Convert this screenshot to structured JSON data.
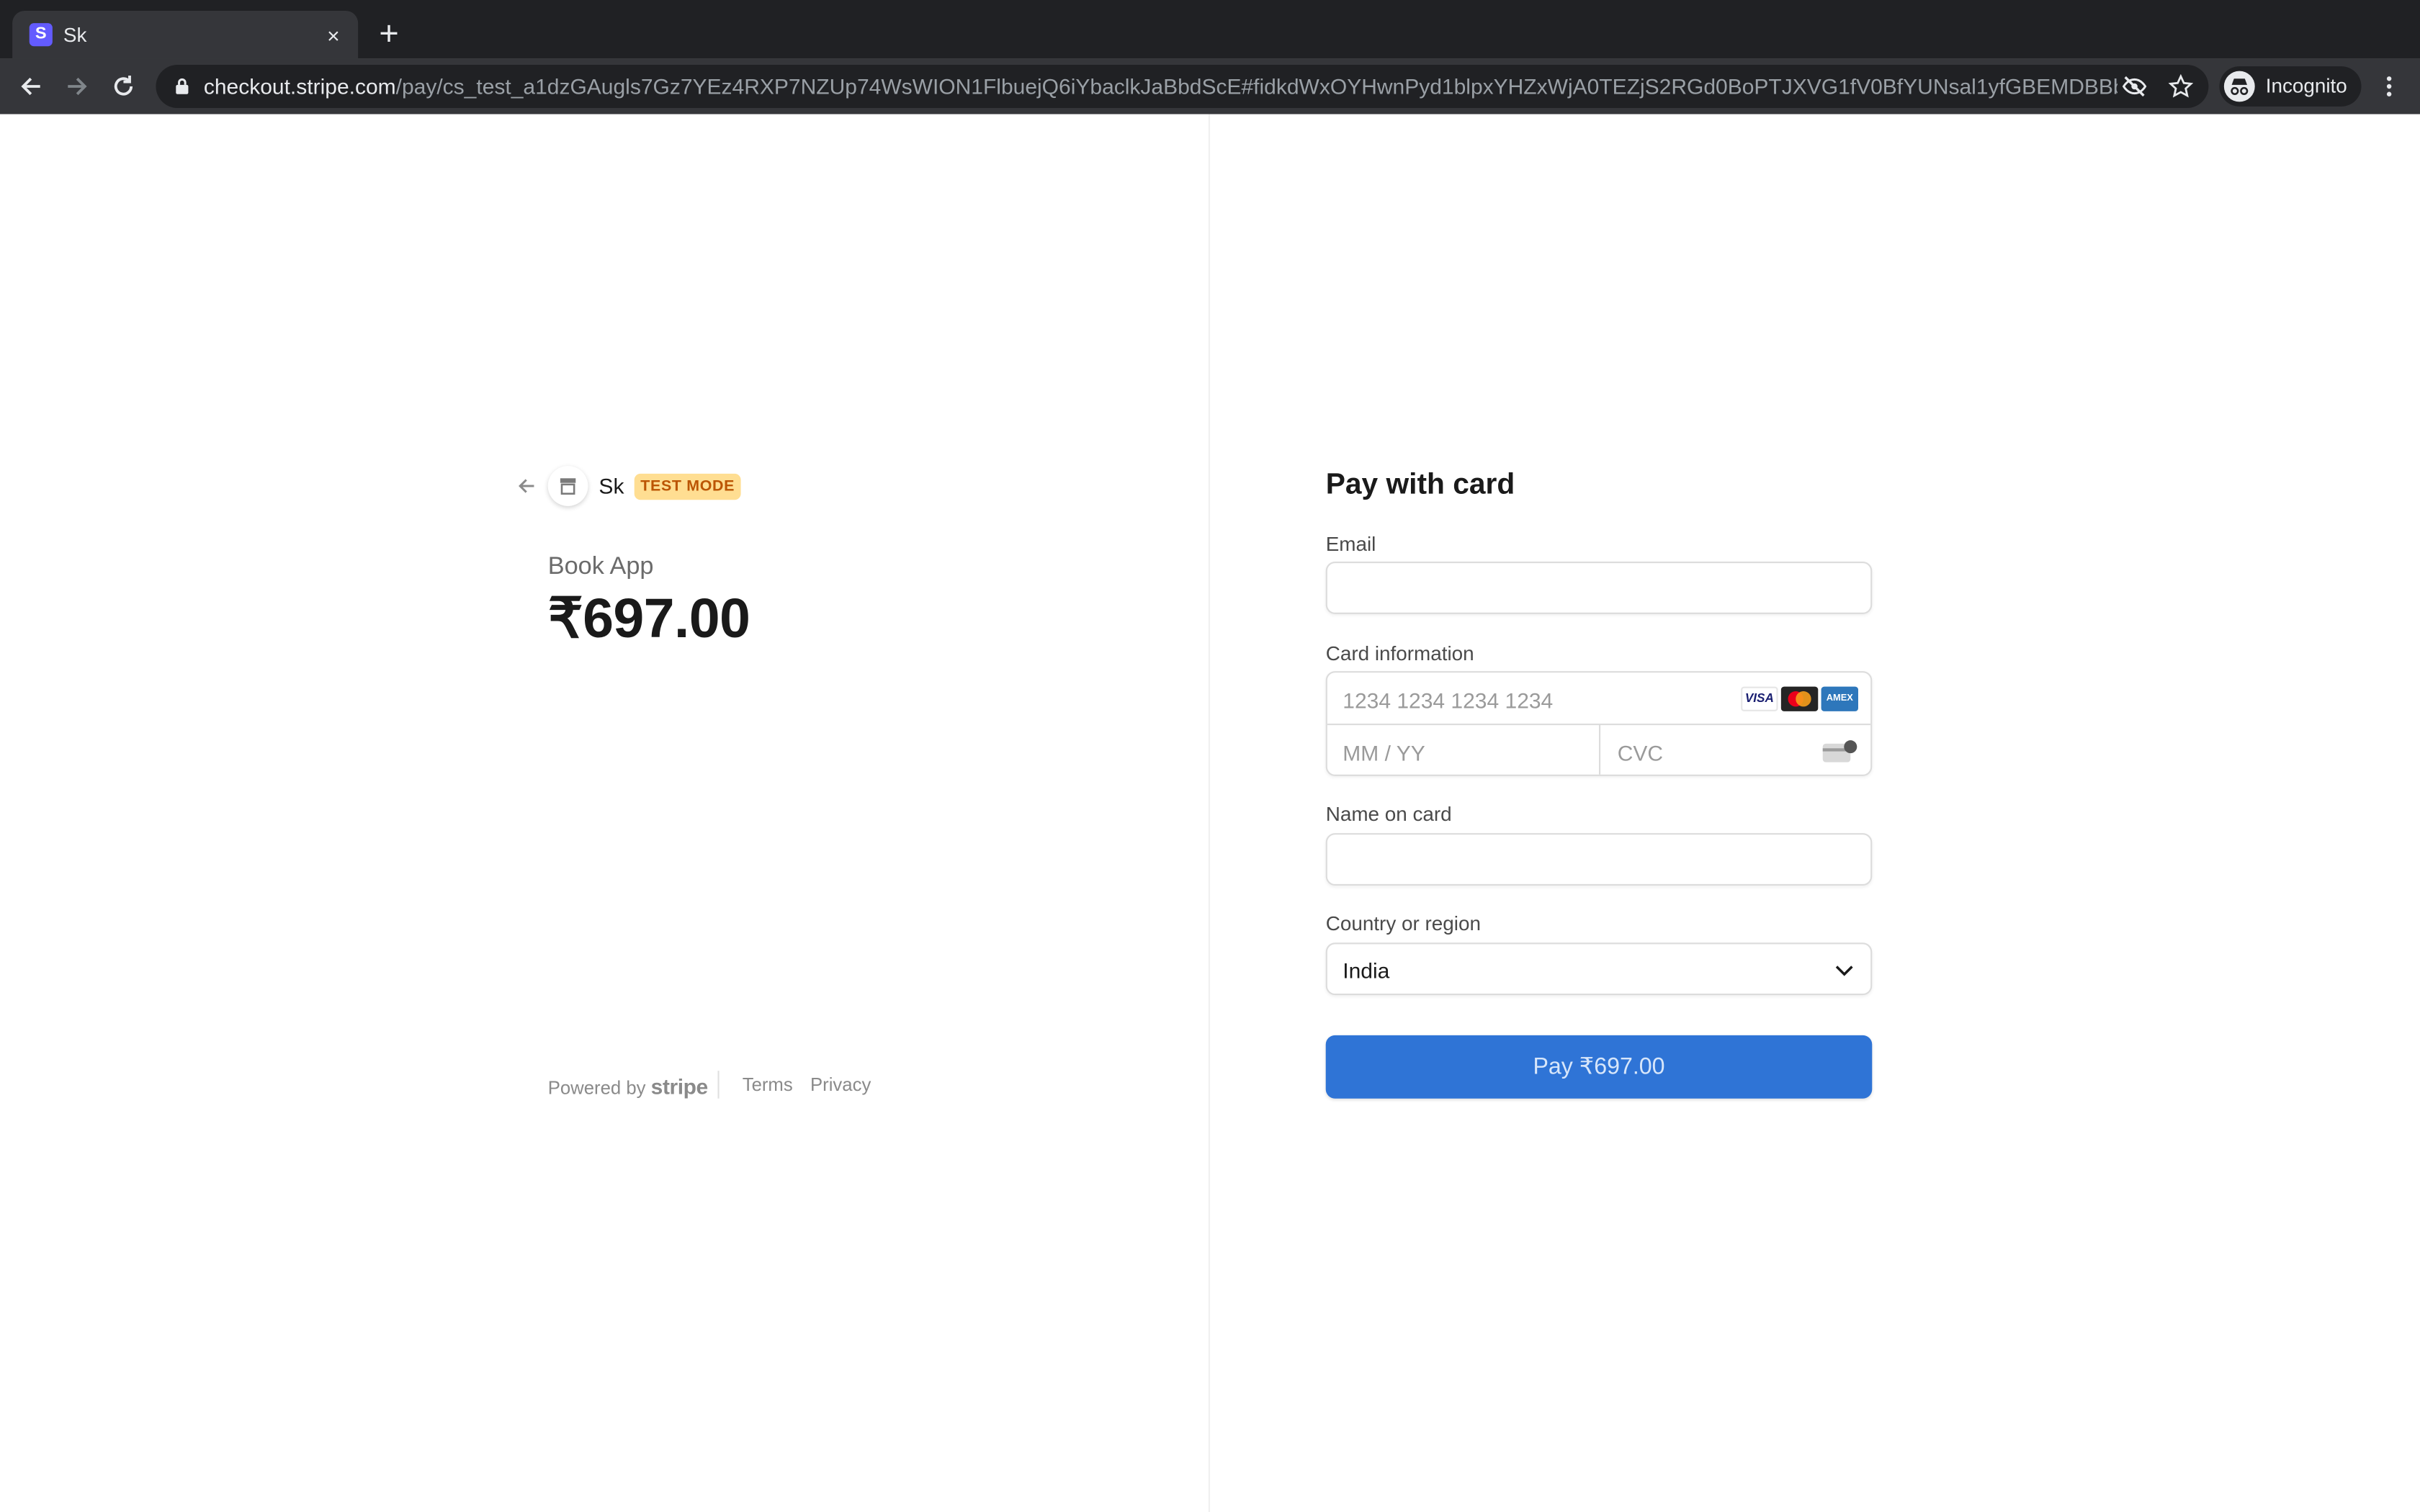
{
  "browser": {
    "tab_title": "Sk",
    "favicon_letter": "S",
    "close_glyph": "×",
    "new_tab_glyph": "+",
    "url_host": "checkout.stripe.com",
    "url_path": "/pay/cs_test_a1dzGAugls7Gz7YEz4RXP7NZUp74WsWION1FlbuejQ6iYbaclkJaBbdScE#fidkdWxOYHwnPyd1blpxYHZxWjA0TEZjS2RGd0BoPTJXVG1fV0BfYUNsal1yfGBEMDBBbG1...",
    "profile_label": "Incognito"
  },
  "summary": {
    "merchant_name": "Sk",
    "test_badge": "TEST MODE",
    "product_name": "Book App",
    "price": "₹697.00"
  },
  "footer": {
    "powered_by": "Powered by",
    "stripe": "stripe",
    "terms": "Terms",
    "privacy": "Privacy"
  },
  "form": {
    "title": "Pay with card",
    "email_label": "Email",
    "email_value": "",
    "card_label": "Card information",
    "card_number_placeholder": "1234 1234 1234 1234",
    "expiry_placeholder": "MM / YY",
    "cvc_placeholder": "CVC",
    "card_brands": [
      "visa-icon",
      "mastercard-icon",
      "amex-icon"
    ],
    "visa_text": "VISA",
    "amex_text": "AMEX",
    "name_label": "Name on card",
    "name_value": "",
    "country_label": "Country or region",
    "country_value": "India",
    "pay_button": "Pay ₹697.00"
  },
  "colors": {
    "chrome_dark": "#202124",
    "chrome_mid": "#35363a",
    "pay_button": "#2f74d6",
    "test_badge_bg": "#ffde92",
    "test_badge_text": "#bb5504",
    "stripe_brand": "#635bff"
  }
}
